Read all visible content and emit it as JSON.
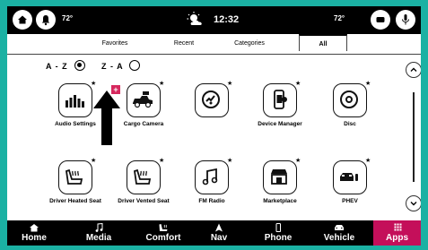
{
  "status": {
    "left_temp": "72°",
    "right_temp": "72°",
    "time": "12:32"
  },
  "tabs": [
    {
      "label": "Favorites"
    },
    {
      "label": "Recent"
    },
    {
      "label": "Categories"
    },
    {
      "label": "All",
      "active": true
    }
  ],
  "sort": {
    "az_label": "A - Z",
    "za_label": "Z - A",
    "selected": "A - Z"
  },
  "apps": [
    {
      "label": "Audio Settings",
      "icon": "audio-settings-icon",
      "favorite": true
    },
    {
      "label": "Cargo Camera",
      "icon": "cargo-camera-icon",
      "favorite": true
    },
    {
      "label": "",
      "icon": "steering-assist-icon",
      "favorite": true
    },
    {
      "label": "Device Manager",
      "icon": "device-manager-icon",
      "favorite": true
    },
    {
      "label": "Disc",
      "icon": "disc-icon",
      "favorite": true
    },
    {
      "label": "Driver Heated Seat",
      "icon": "heated-seat-icon",
      "favorite": true
    },
    {
      "label": "Driver Vented Seat",
      "icon": "vented-seat-icon",
      "favorite": true
    },
    {
      "label": "FM Radio",
      "icon": "fm-radio-icon",
      "favorite": true
    },
    {
      "label": "Marketplace",
      "icon": "marketplace-icon",
      "favorite": true
    },
    {
      "label": "PHEV",
      "icon": "phev-icon",
      "favorite": true
    }
  ],
  "nav": [
    {
      "label": "Home",
      "icon": "home-icon"
    },
    {
      "label": "Media",
      "icon": "music-note-icon"
    },
    {
      "label": "Comfort",
      "icon": "comfort-icon"
    },
    {
      "label": "Nav",
      "icon": "navigation-arrow-icon"
    },
    {
      "label": "Phone",
      "icon": "phone-icon"
    },
    {
      "label": "Vehicle",
      "icon": "vehicle-icon"
    },
    {
      "label": "Apps",
      "icon": "apps-grid-icon",
      "active": true
    }
  ],
  "colors": {
    "frame": "#1bb1a3",
    "accent": "#c40f5a",
    "badge": "#d6285e"
  }
}
